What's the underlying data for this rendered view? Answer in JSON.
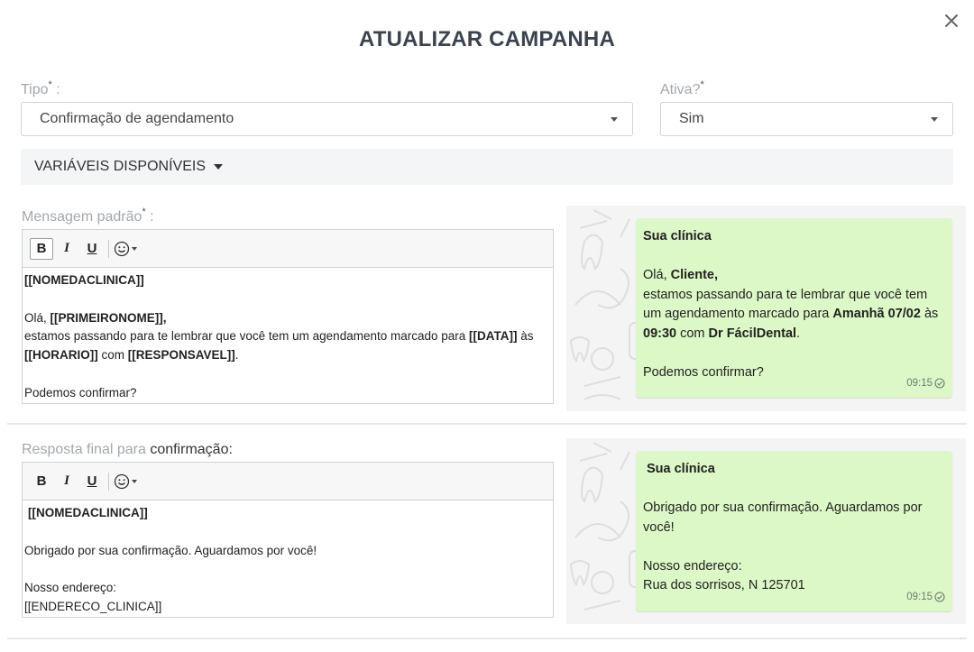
{
  "modal": {
    "title": "ATUALIZAR CAMPANHA"
  },
  "form": {
    "tipo": {
      "label": "Tipo",
      "required_mark": "*",
      "colon": " :",
      "selected": "Confirmação de agendamento"
    },
    "ativa": {
      "label": "Ativa?",
      "required_mark": "*",
      "selected": "Sim"
    },
    "variables_toggle": "VARIÁVEIS DISPONÍVEIS"
  },
  "default_message": {
    "label": "Mensagem padrão",
    "required_mark": "*",
    "colon": " :",
    "toolbar": {
      "bold": "B",
      "italic": "I",
      "underline": "U"
    },
    "body": {
      "l1": "[[NOMEDACLINICA]]",
      "l3a": "Olá, ",
      "l3b": "[[PRIMEIRONOME]],",
      "l4a": "estamos passando para te lembrar que você tem um agendamento marcado para ",
      "l4b": "[[DATA]]",
      "l4c": " às",
      "l5a": "[[HORARIO]]",
      "l5b": " com ",
      "l5c": "[[RESPONSAVEL]]",
      "l5d": ".",
      "l7": "Podemos confirmar?"
    },
    "preview": {
      "sender": "Sua clínica",
      "l3a": "Olá, ",
      "l3b": "Cliente,",
      "l4": "estamos passando para te lembrar que você tem",
      "l5a": "um agendamento marcado para ",
      "l5b": "Amanhã 07/02",
      "l5c": " às",
      "l6a": "09:30",
      "l6b": " com ",
      "l6c": "Dr FácilDental",
      "l6d": ".",
      "l8": "Podemos confirmar?",
      "time": "09:15"
    }
  },
  "final_response": {
    "label_muted": "Resposta final para ",
    "label_strong": "confirmação:",
    "toolbar": {
      "bold": "B",
      "italic": "I",
      "underline": "U"
    },
    "body": {
      "l1": "[[NOMEDACLINICA]]",
      "l3": "Obrigado por sua confirmação. Aguardamos por você!",
      "l5": "Nosso endereço:",
      "l6": "[[ENDERECO_CLINICA]]"
    },
    "preview": {
      "sender": "Sua clínica",
      "l3": "Obrigado por sua confirmação. Aguardamos por",
      "l4": "você!",
      "l6": "Nosso endereço:",
      "l7": "Rua dos sorrisos, N 125701",
      "time": "09:15"
    }
  },
  "colors": {
    "bubble": "#dcf8c6",
    "title": "#3b4350",
    "muted_label": "#a3a8ad"
  },
  "icons": [
    "close-icon",
    "emoji-icon",
    "check-circle-icon",
    "chevron-down-icon"
  ]
}
